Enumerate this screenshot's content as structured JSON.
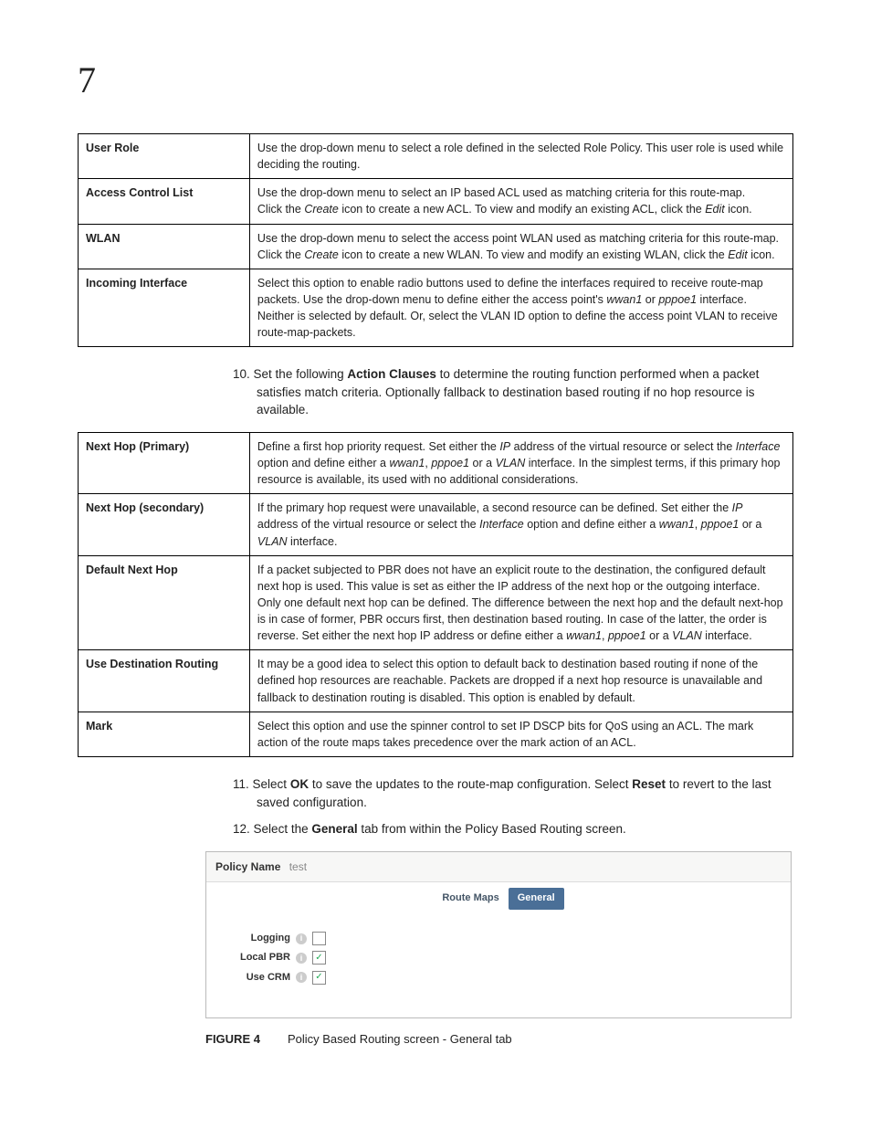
{
  "page_number": "7",
  "table1": [
    {
      "label": "User Role",
      "desc": [
        {
          "t": "Use the drop-down menu to select a role defined in the selected Role Policy. This user role is used while deciding the routing."
        }
      ]
    },
    {
      "label": "Access Control List",
      "desc": [
        {
          "t": "Use the drop-down menu to select an IP based ACL used as matching criteria for this route-map."
        },
        {
          "t": "Click the ",
          "next": [
            {
              "i": "Create"
            },
            {
              "t": " icon to create a new ACL. To view and modify an existing ACL, click the "
            },
            {
              "i": "Edit"
            },
            {
              "t": " icon."
            }
          ]
        }
      ]
    },
    {
      "label": "WLAN",
      "desc": [
        {
          "t": "Use the drop-down menu to select the access point WLAN used as matching criteria for this route-map."
        },
        {
          "t": "Click the ",
          "next": [
            {
              "i": "Create"
            },
            {
              "t": " icon to create a new WLAN. To view and modify an existing WLAN, click the "
            },
            {
              "i": "Edit"
            },
            {
              "t": " icon."
            }
          ]
        }
      ]
    },
    {
      "label": "Incoming Interface",
      "desc": [
        {
          "t": "Select this option to enable radio buttons used to define the interfaces required to receive route-map packets. Use the drop-down menu to define either the access point's ",
          "next": [
            {
              "i": "wwan1"
            },
            {
              "t": " or "
            },
            {
              "i": "pppoe1"
            },
            {
              "t": " interface. Neither is selected by default. Or, select the VLAN ID option to define the access point VLAN to receive route-map-packets."
            }
          ]
        }
      ]
    }
  ],
  "step10": {
    "num": "10.",
    "text_before": "Set the following ",
    "bold": "Action Clauses",
    "text_after": " to determine the routing function performed when a packet satisfies match criteria. Optionally fallback to destination based routing if no hop resource is available."
  },
  "table2": [
    {
      "label": "Next Hop (Primary)",
      "desc": [
        {
          "t": "Define a first hop priority request. Set either the ",
          "next": [
            {
              "i": "IP"
            },
            {
              "t": " address of the virtual resource or select the "
            },
            {
              "i": "Interface"
            },
            {
              "t": " option and define either a "
            },
            {
              "i": "wwan1"
            },
            {
              "t": ", "
            },
            {
              "i": "pppoe1"
            },
            {
              "t": " or a "
            },
            {
              "i": "VLAN"
            },
            {
              "t": " interface. In the simplest terms, if this primary hop resource is available, its used with no additional considerations."
            }
          ]
        }
      ]
    },
    {
      "label": "Next Hop (secondary)",
      "desc": [
        {
          "t": "If the primary hop request were unavailable, a second resource can be defined. Set either the ",
          "next": [
            {
              "i": "IP"
            },
            {
              "t": " address of the virtual resource or select the "
            },
            {
              "i": "Interface"
            },
            {
              "t": " option and define either a "
            },
            {
              "i": "wwan1"
            },
            {
              "t": ", "
            },
            {
              "i": "pppoe1"
            },
            {
              "t": " or a "
            },
            {
              "i": "VLAN"
            },
            {
              "t": " interface."
            }
          ]
        }
      ]
    },
    {
      "label": "Default Next Hop",
      "desc": [
        {
          "t": "If a packet subjected to PBR does not have an explicit route to the destination, the configured default next hop is used. This value is set as either the IP address of the next hop or the outgoing interface. Only one default next hop can be defined. The difference between the next hop and the default next-hop is in case of former, PBR occurs first, then destination based routing. In case of the latter, the order is reverse. Set either the next hop IP address or define either a ",
          "next": [
            {
              "i": "wwan1"
            },
            {
              "t": ", "
            },
            {
              "i": "pppoe1"
            },
            {
              "t": " or a "
            },
            {
              "i": "VLAN"
            },
            {
              "t": " interface."
            }
          ]
        }
      ]
    },
    {
      "label": "Use Destination Routing",
      "desc": [
        {
          "t": "It may be a good idea to select this option to default back to destination based routing if none of the defined hop resources are reachable. Packets are dropped if a next hop resource is unavailable and fallback to destination routing is disabled. This option is enabled by default."
        }
      ]
    },
    {
      "label": "Mark",
      "desc": [
        {
          "t": "Select this option and use the spinner control to set IP DSCP bits for QoS using an ACL. The mark action of the route maps takes precedence over the mark action of an ACL."
        }
      ]
    }
  ],
  "step11": {
    "num": "11.",
    "pre": "Select ",
    "b1": "OK",
    "mid": " to save the updates to the route-map configuration. Select ",
    "b2": "Reset",
    "post": " to revert to the last saved configuration."
  },
  "step12": {
    "num": "12.",
    "pre": "Select the ",
    "b1": "General",
    "post": " tab from within the Policy Based Routing screen."
  },
  "figure": {
    "policy_name_label": "Policy Name",
    "policy_name_value": "test",
    "tab_routemaps": "Route Maps",
    "tab_general": "General",
    "row_logging": "Logging",
    "row_localpbr": "Local PBR",
    "row_usecrm": "Use CRM",
    "logging_checked": false,
    "localpbr_checked": true,
    "usecrm_checked": true
  },
  "caption": {
    "num": "FIGURE 4",
    "text": "Policy Based Routing screen - General tab"
  }
}
